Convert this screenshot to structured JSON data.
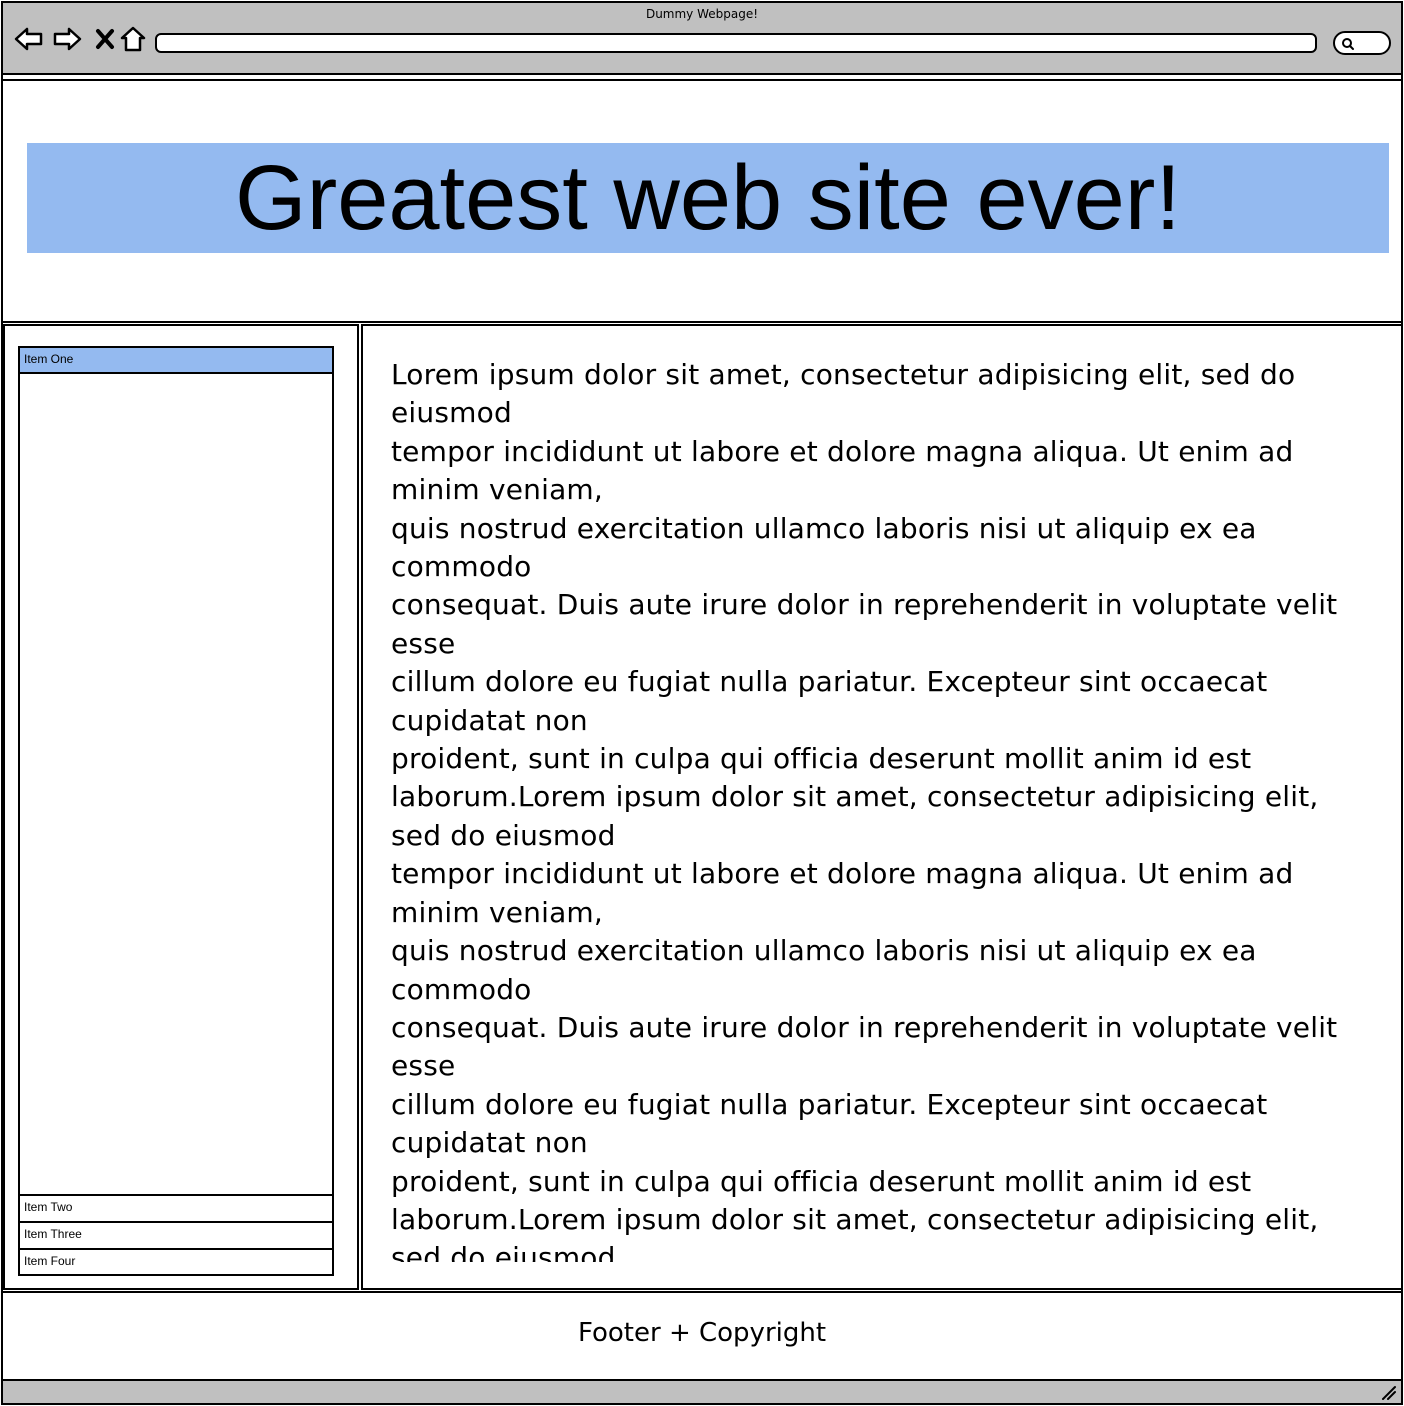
{
  "window": {
    "title": "Dummy Webpage!",
    "url": ""
  },
  "toolbar": {
    "back_icon": "back-arrow-icon",
    "forward_icon": "forward-arrow-icon",
    "stop_icon": "close-icon",
    "home_icon": "home-icon",
    "search_icon": "search-icon"
  },
  "header": {
    "title": "Greatest web site ever!",
    "banner_color": "#94baf0"
  },
  "sidebar": {
    "items": [
      {
        "label": "Item One",
        "selected": true
      },
      {
        "label": "Item Two",
        "selected": false
      },
      {
        "label": "Item Three",
        "selected": false
      },
      {
        "label": "Item Four",
        "selected": false
      }
    ]
  },
  "main": {
    "body_text": "Lorem ipsum dolor sit amet, consectetur adipisicing elit, sed do eiusmod\ntempor incididunt ut labore et dolore magna aliqua. Ut enim ad minim veniam,\nquis nostrud exercitation ullamco laboris nisi ut aliquip ex ea commodo\nconsequat. Duis aute irure dolor in reprehenderit in voluptate velit esse\ncillum dolore eu fugiat nulla pariatur. Excepteur sint occaecat cupidatat non\nproident, sunt in culpa qui officia deserunt mollit anim id est laborum.Lorem ipsum dolor sit amet, consectetur adipisicing elit, sed do eiusmod\ntempor incididunt ut labore et dolore magna aliqua. Ut enim ad minim veniam,\nquis nostrud exercitation ullamco laboris nisi ut aliquip ex ea commodo\nconsequat. Duis aute irure dolor in reprehenderit in voluptate velit esse\ncillum dolore eu fugiat nulla pariatur. Excepteur sint occaecat cupidatat non\nproident, sunt in culpa qui officia deserunt mollit anim id est laborum.Lorem ipsum dolor sit amet, consectetur adipisicing elit, sed do eiusmod"
  },
  "footer": {
    "text": "Footer + Copyright"
  },
  "colors": {
    "chrome": "#c0c0c0",
    "accent": "#94baf0"
  }
}
